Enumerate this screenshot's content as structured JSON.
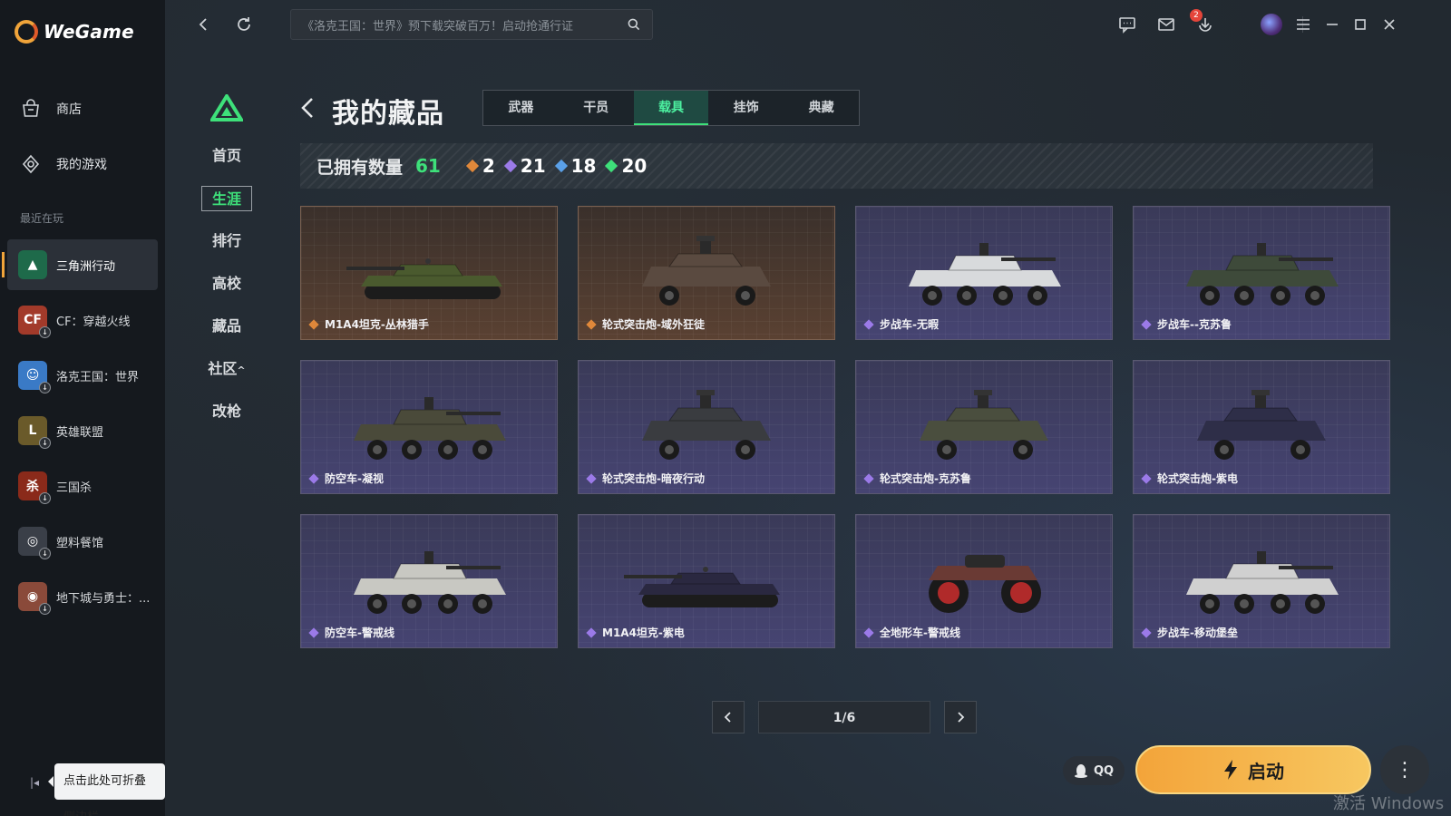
{
  "app": {
    "brand": "WeGame",
    "nav": {
      "store": "商店",
      "my_games": "我的游戏"
    },
    "recent_label": "最近在玩",
    "recent_games": [
      {
        "label": "三角洲行动",
        "icon": "delta-force-icon",
        "color": "#1e6a4a",
        "glyph": "▲"
      },
      {
        "label": "CF：穿越火线",
        "icon": "crossfire-icon",
        "color": "#a23a2a",
        "glyph": "CF"
      },
      {
        "label": "洛克王国：世界",
        "icon": "roco-kingdom-icon",
        "color": "#3a7ac6",
        "glyph": "☺"
      },
      {
        "label": "英雄联盟",
        "icon": "league-of-legends-icon",
        "color": "#6a5a2a",
        "glyph": "L"
      },
      {
        "label": "三国杀",
        "icon": "sanguosha-icon",
        "color": "#8a2a1a",
        "glyph": "杀"
      },
      {
        "label": "塑料餐馆",
        "icon": "plastic-restaurant-icon",
        "color": "#3a3f48",
        "glyph": "◎"
      },
      {
        "label": "地下城与勇士：...",
        "icon": "dnf-icon",
        "color": "#8a4a3a",
        "glyph": "◉"
      }
    ],
    "collapse_tip": "点击此处可折叠侧边栏"
  },
  "topbar": {
    "search_placeholder": "《洛克王国：世界》预下载突破百万！启动抢通行证",
    "mail_badge": "2"
  },
  "game_nav": {
    "items": [
      "首页",
      "生涯",
      "排行",
      "高校",
      "藏品",
      "社区",
      "改枪"
    ],
    "community_suffix": "^",
    "active_index": 1
  },
  "collection": {
    "title": "我的藏品",
    "tabs": [
      "武器",
      "干员",
      "载具",
      "挂饰",
      "典藏"
    ],
    "active_tab": 2,
    "owned_label": "已拥有数量",
    "owned_total": "61",
    "rarity_counts": [
      {
        "value": "2",
        "color": "#e0883a"
      },
      {
        "value": "21",
        "color": "#9b7ae8"
      },
      {
        "value": "18",
        "color": "#5aa0e8"
      },
      {
        "value": "20",
        "color": "#3ee07a"
      }
    ],
    "items": [
      {
        "name": "M1A4坦克-丛林猎手",
        "rarity": "gold",
        "type": "tank",
        "paint": "#4a5a2e"
      },
      {
        "name": "轮式突击炮-域外狂徒",
        "rarity": "gold",
        "type": "armored-car",
        "paint": "#5a4a40"
      },
      {
        "name": "步战车-无暇",
        "rarity": "purple",
        "type": "ifv",
        "paint": "#d8dadc"
      },
      {
        "name": "步战车--克苏鲁",
        "rarity": "purple",
        "type": "ifv",
        "paint": "#3e4a3a"
      },
      {
        "name": "防空车-凝视",
        "rarity": "purple",
        "type": "ifv",
        "paint": "#4a4a3a"
      },
      {
        "name": "轮式突击炮-暗夜行动",
        "rarity": "purple",
        "type": "armored-car",
        "paint": "#3a3c40"
      },
      {
        "name": "轮式突击炮-克苏鲁",
        "rarity": "purple",
        "type": "armored-car",
        "paint": "#4a4e3e"
      },
      {
        "name": "轮式突击炮-紫电",
        "rarity": "purple",
        "type": "armored-car",
        "paint": "#2e2e48"
      },
      {
        "name": "防空车-警戒线",
        "rarity": "purple",
        "type": "ifv",
        "paint": "#c8c8c2"
      },
      {
        "name": "M1A4坦克-紫电",
        "rarity": "purple",
        "type": "tank",
        "paint": "#2a2840"
      },
      {
        "name": "全地形车-警戒线",
        "rarity": "purple",
        "type": "atv",
        "paint": "#6a3a34"
      },
      {
        "name": "步战车-移动堡垒",
        "rarity": "purple",
        "type": "ifv",
        "paint": "#d0d0d0"
      }
    ],
    "pager": "1/6"
  },
  "actions": {
    "qq_label": "QQ",
    "launch_label": "启动",
    "more_label": "⋮"
  },
  "watermark": "激活 Windows",
  "colors": {
    "accent_green": "#3ee07a",
    "launch_orange": "#f3a43a",
    "gold_diamond": "#e0883a",
    "purple_diamond": "#9b7ae8"
  }
}
